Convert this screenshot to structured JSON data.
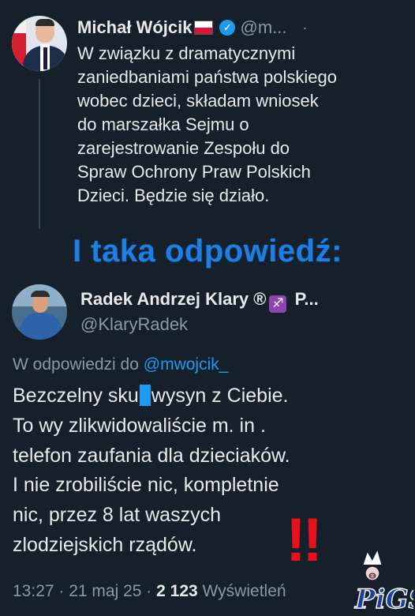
{
  "tweet1": {
    "display_name": "Michał Wójcik",
    "handle": "@m...",
    "more": "·",
    "text": "W związku z dramatycznymi\nzaniedbaniami państwa polskiego\nwobec dzieci, składam wniosek\ndo marszałka Sejmu o\nzarejestrowanie Zespołu do\nSpraw Ochrony Praw Polskich\nDzieci. Będzie się działo."
  },
  "banner": "I taka odpowiedź:",
  "tweet2": {
    "display_name_before": "Radek Andrzej Klary ®",
    "display_name_after": " P...",
    "handle": "@KlaryRadek",
    "reply_prefix": "W odpowiedzi do ",
    "reply_mention": "@mwojcik_",
    "line1_before": "Bezczelny sku",
    "line1_after": "wysyn z Ciebie.",
    "line2": "To wy zlikwidowaliście m. in .",
    "line3": "telefon zaufania dla dzieciaków.",
    "line4": "I nie zrobiliście nic, kompletnie",
    "line5": "nic, przez 8 lat waszych",
    "line6": "zlodziejskich rządów.",
    "time": "13:27",
    "date": "21 maj 25",
    "views_count": "2 123",
    "views_label": "Wyświetleń",
    "separator": " · "
  },
  "decor": {
    "exclaim": "‼",
    "sagittarius": "♐",
    "verified_mark": "✓",
    "watermark_text": "PiGS"
  },
  "colors": {
    "background": "#15202b",
    "text": "#e7e9ea",
    "secondary": "#8b98a5",
    "accent": "#1d9bf0",
    "banner": "#1f7ee0",
    "alert": "#e8101c"
  }
}
